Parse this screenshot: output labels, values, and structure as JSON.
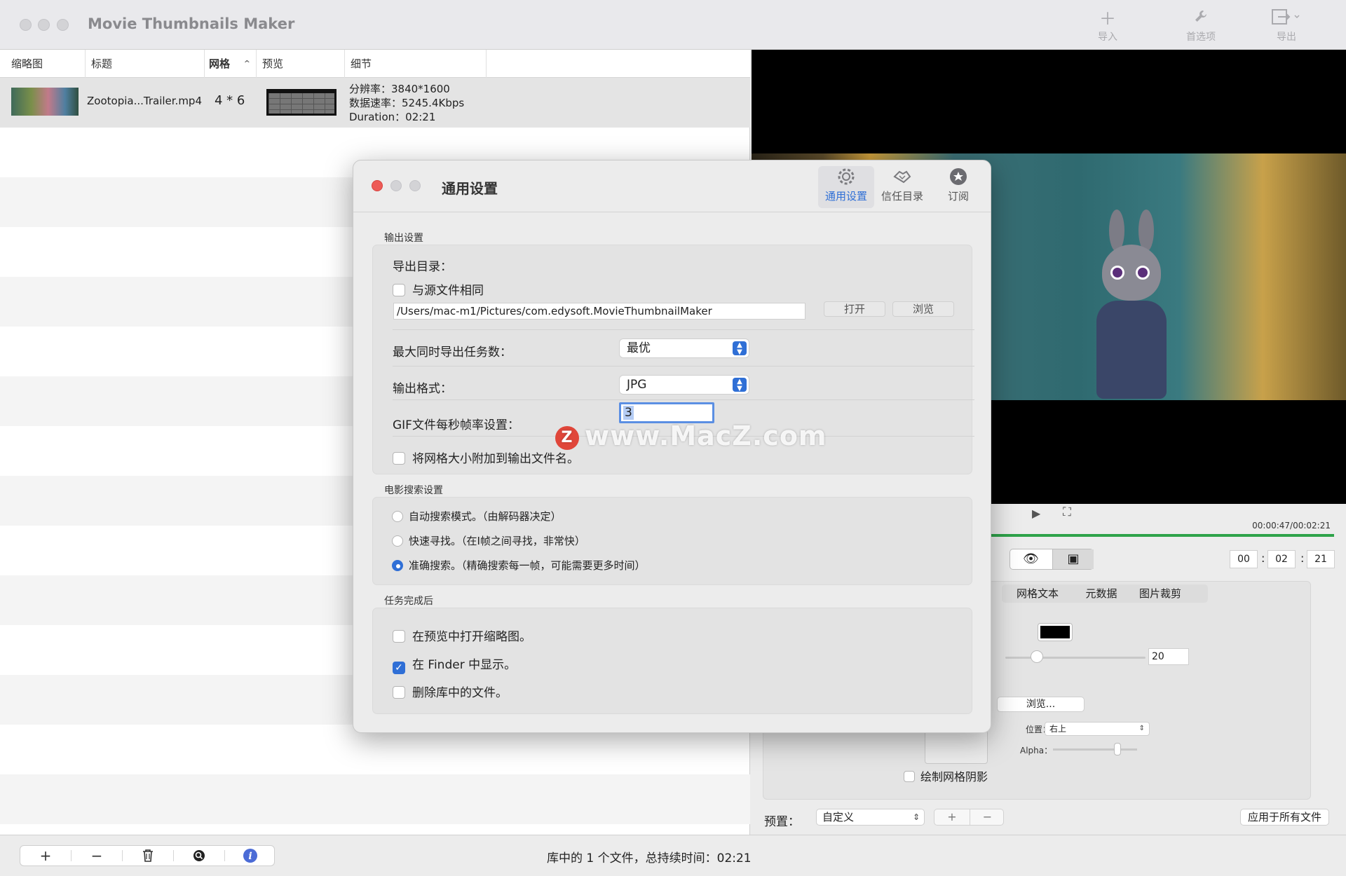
{
  "window": {
    "title": "Movie Thumbnails Maker",
    "toolbar": [
      {
        "label": "导入",
        "icon": "plus-icon"
      },
      {
        "label": "首选项",
        "icon": "wrench-icon"
      },
      {
        "label": "导出",
        "icon": "export-icon"
      }
    ]
  },
  "table": {
    "headers": [
      "缩略图",
      "标题",
      "网格",
      "预览",
      "细节"
    ],
    "rows": [
      {
        "title": "Zootopia...Trailer.mp4",
        "grid": "4 * 6",
        "detail_lines": [
          "分辨率：3840*1600",
          "数据速率：5245.4Kbps",
          "Duration：02:21"
        ]
      }
    ]
  },
  "bottom_bar": {
    "buttons": [
      "+",
      "−"
    ],
    "status": "库中的 1 个文件，总持续时间：02:21"
  },
  "player": {
    "timecode": "00:00:47/00:02:21",
    "progress": 0.98,
    "time_fields": [
      "00",
      "02",
      "21"
    ],
    "tabs": [
      "网格文本",
      "元数据",
      "图片裁剪"
    ],
    "font_size_value": "20",
    "browse_label": "浏览...",
    "position_label": "位置：",
    "position_value": "右上",
    "alpha_label": "Alpha：",
    "shadow_label": "绘制网格阴影",
    "preset_label": "预置：",
    "preset_value": "自定义",
    "apply_all_label": "应用于所有文件",
    "accent_color": "#2ea34a"
  },
  "dialog": {
    "title": "通用设置",
    "tabs": [
      {
        "label": "通用设置",
        "icon": "gear-icon",
        "active": true
      },
      {
        "label": "信任目录",
        "icon": "hand-shake-icon",
        "active": false
      },
      {
        "label": "订阅",
        "icon": "star-badge-icon",
        "active": false
      }
    ],
    "output": {
      "section": "输出设置",
      "export_dir_label": "导出目录：",
      "same_as_source_label": "与源文件相同",
      "same_as_source_checked": false,
      "path": "/Users/mac-m1/Pictures/com.edysoft.MovieThumbnailMaker",
      "open_label": "打开",
      "browse_label": "浏览",
      "max_tasks_label": "最大同时导出任务数：",
      "max_tasks_value": "最优",
      "format_label": "输出格式：",
      "format_value": "JPG",
      "gif_fps_label": "GIF文件每秒帧率设置：",
      "gif_fps_value": "3",
      "append_grid_label": "将网格大小附加到输出文件名。",
      "append_grid_checked": false
    },
    "seek": {
      "section": "电影搜索设置",
      "options": [
        {
          "label": "自动搜索模式。（由解码器决定）",
          "selected": false
        },
        {
          "label": "快速寻找。（在I帧之间寻找，非常快）",
          "selected": false
        },
        {
          "label": "准确搜索。（精确搜索每一帧，可能需要更多时间）",
          "selected": true
        }
      ]
    },
    "after": {
      "section": "任务完成后",
      "options": [
        {
          "label": "在预览中打开缩略图。",
          "checked": false
        },
        {
          "label": "在 Finder 中显示。",
          "checked": true
        },
        {
          "label": "删除库中的文件。",
          "checked": false
        }
      ]
    },
    "accent_color": "#2f6fd6"
  },
  "watermark": {
    "text": "www.MacZ.com",
    "logo_letter": "Z"
  }
}
